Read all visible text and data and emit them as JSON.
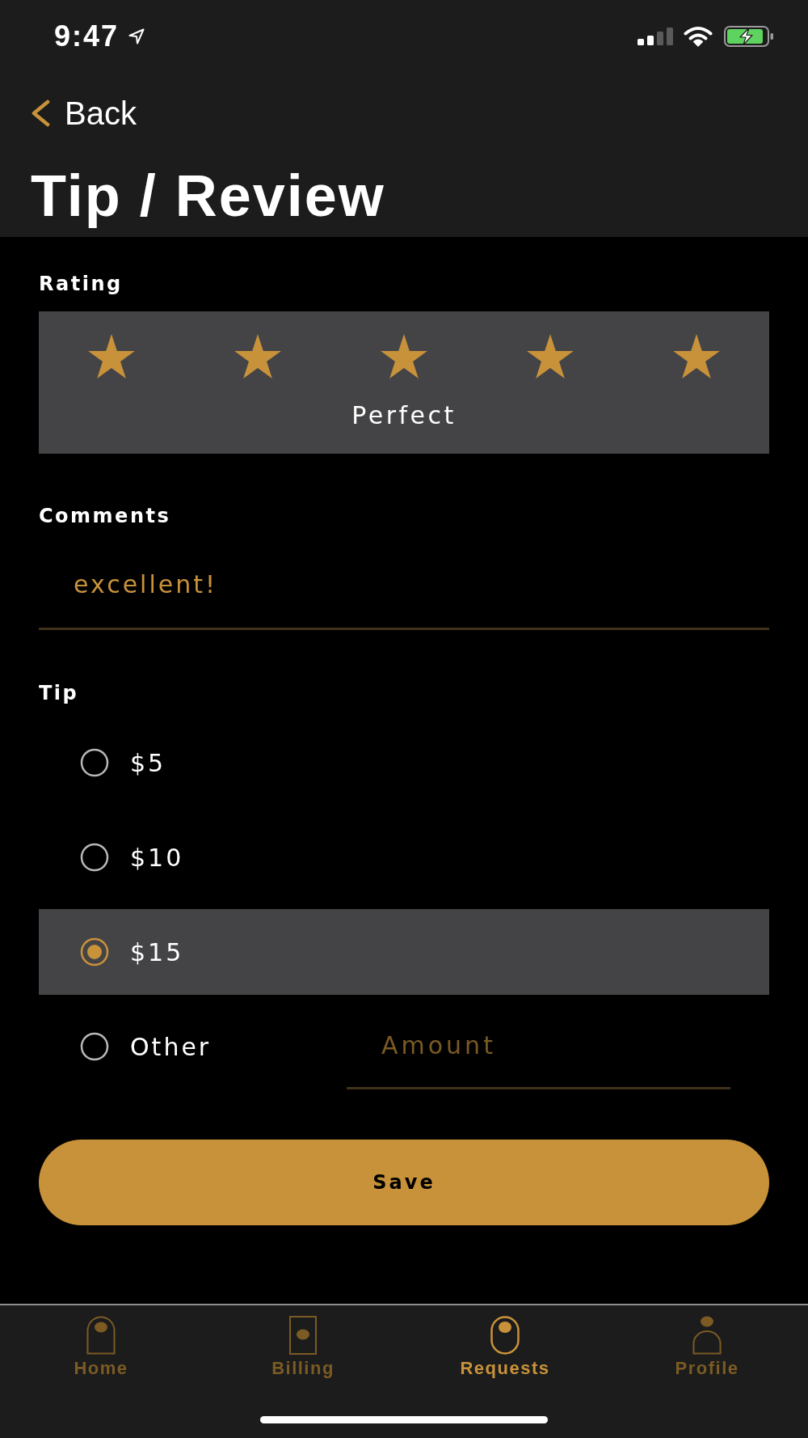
{
  "status_bar": {
    "time": "9:47"
  },
  "navigation": {
    "back": "Back",
    "title": "Tip / Review"
  },
  "rating": {
    "label": "Rating",
    "stars": 5,
    "caption": "Perfect"
  },
  "comments": {
    "label": "Comments",
    "value": "excellent!"
  },
  "tip": {
    "label": "Tip",
    "options": [
      {
        "label": "$5",
        "selected": false
      },
      {
        "label": "$10",
        "selected": false
      },
      {
        "label": "$15",
        "selected": true
      },
      {
        "label": "Other",
        "selected": false,
        "amount": {
          "placeholder": "Amount"
        }
      }
    ]
  },
  "save_button": "Save",
  "tab_bar": [
    {
      "kind": "home",
      "label": "Home",
      "selected": false
    },
    {
      "kind": "billing",
      "label": "Billing",
      "selected": false
    },
    {
      "kind": "requests",
      "label": "Requests",
      "selected": true
    },
    {
      "kind": "profile",
      "label": "Profile",
      "selected": false
    }
  ]
}
